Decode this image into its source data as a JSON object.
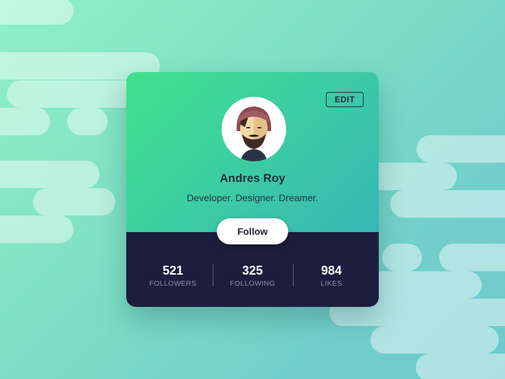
{
  "profile": {
    "edit_label": "EDIT",
    "name": "Andres Roy",
    "bio": "Developer. Designer. Dreamer.",
    "follow_label": "Follow"
  },
  "stats": [
    {
      "value": "521",
      "label": "FOLLOWERS"
    },
    {
      "value": "325",
      "label": "FOLLOWING"
    },
    {
      "value": "984",
      "label": "LIKES"
    }
  ],
  "colors": {
    "card_gradient_start": "#43e08e",
    "card_gradient_end": "#36b8b6",
    "card_bottom": "#1c1e3e",
    "stat_label": "#8a90a8",
    "button_bg": "#ffffff"
  },
  "icons": {
    "avatar": "bearded-man-with-beanie-avatar"
  }
}
